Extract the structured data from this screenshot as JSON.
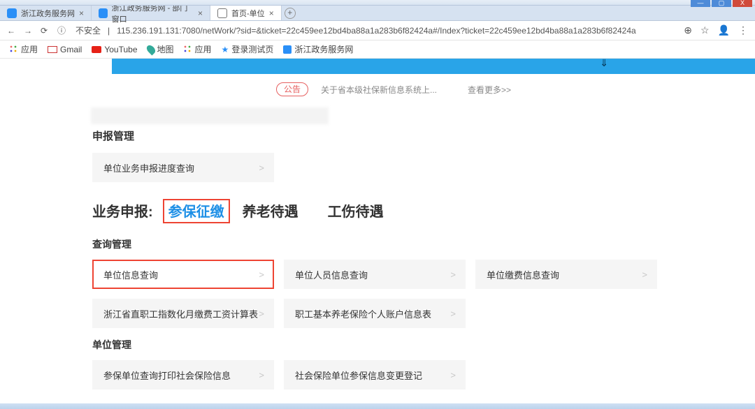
{
  "window_buttons": {
    "min": "—",
    "max": "▢",
    "close": "X"
  },
  "tabs": [
    {
      "title": "浙江政务服务网",
      "close": "×"
    },
    {
      "title": "浙江政务服务网 - 部门窗口",
      "close": "×"
    },
    {
      "title": "首页-单位",
      "close": "×"
    }
  ],
  "newtab": "+",
  "nav": {
    "back": "←",
    "fwd": "→",
    "reload": "⟳"
  },
  "addr": {
    "insecure_icon": "ⓘ",
    "insecure_text": "不安全",
    "sep": "|",
    "url": "115.236.191.131:7080/netWork/?sid=&ticket=22c459ee12bd4ba88a1a283b6f82424a#/Index?ticket=22c459ee12bd4ba88a1a283b6f82424a",
    "magnify": "⊕",
    "star": "☆",
    "avatar": "👤",
    "kebab": "⋮"
  },
  "bookmarks": [
    {
      "label": "应用",
      "icon": "grid"
    },
    {
      "label": "Gmail",
      "icon": "gmail"
    },
    {
      "label": "YouTube",
      "icon": "yt"
    },
    {
      "label": "地图",
      "icon": "map"
    },
    {
      "label": "应用",
      "icon": "grid"
    },
    {
      "label": "登录测试页",
      "icon": "star"
    },
    {
      "label": "浙江政务服务网",
      "icon": "blue"
    }
  ],
  "banner_arrow": "⇓",
  "notice": {
    "badge": "公告",
    "text": "关于省本级社保新信息系统上...",
    "more": "查看更多>>"
  },
  "sec1_title": "申报管理",
  "sec1_tile": "单位业务申报进度查询",
  "cats": {
    "lead": "业务申报:",
    "c1": "参保征缴",
    "c2": "养老待遇",
    "c3": "工伤待遇"
  },
  "sec2_title": "查询管理",
  "row1": [
    "单位信息查询",
    "单位人员信息查询",
    "单位缴费信息查询"
  ],
  "row2": [
    "浙江省直职工指数化月缴费工资计算表",
    "职工基本养老保险个人账户信息表"
  ],
  "sec3_title": "单位管理",
  "row3": [
    "参保单位查询打印社会保险信息",
    "社会保险单位参保信息变更登记"
  ],
  "chev": ">"
}
